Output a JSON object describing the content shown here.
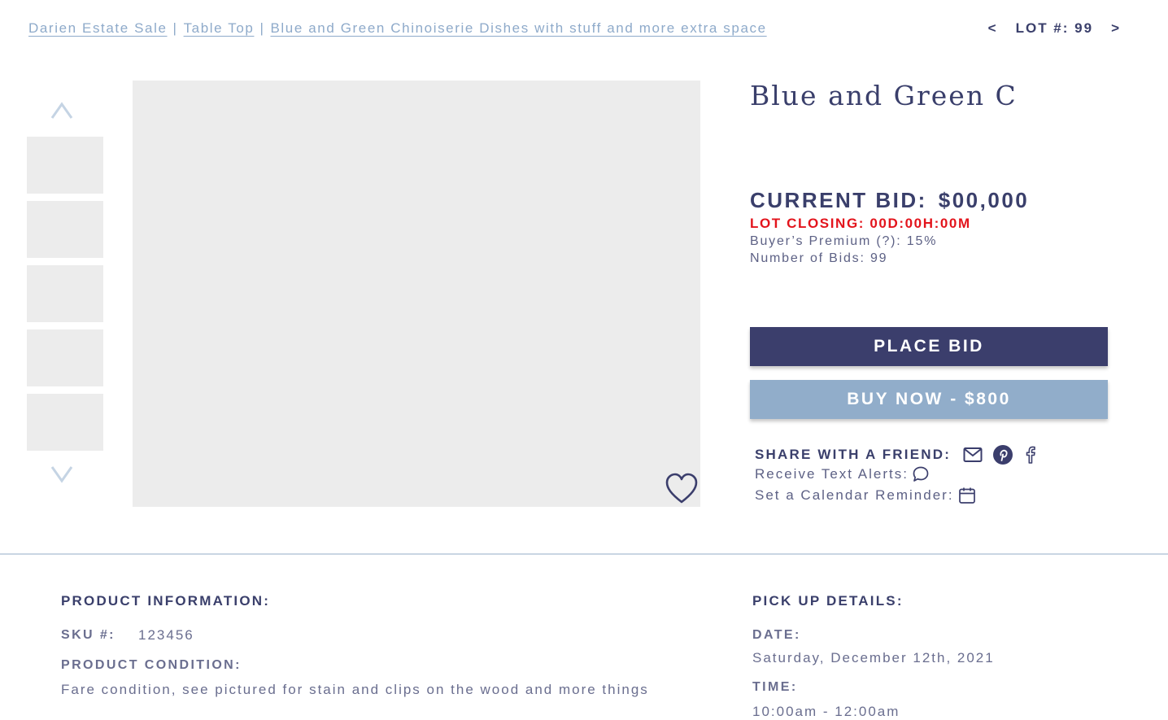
{
  "breadcrumb": {
    "items": [
      "Darien Estate Sale",
      "Table Top",
      "Blue and Green Chinoiserie Dishes with stuff and more extra space"
    ],
    "separator": "|"
  },
  "lot_nav": {
    "prev": "<",
    "label": "LOT #: 99",
    "next": ">"
  },
  "gallery": {
    "up_icon": "chevron-up-icon",
    "down_icon": "chevron-down-icon",
    "thumbnail_count": 5,
    "favorite_icon": "heart-icon"
  },
  "lot": {
    "title": "Blue and Green C",
    "current_bid_label": "CURRENT BID:",
    "current_bid_value": "$00,000",
    "closing": "LOT CLOSING: 00D:00H:00M",
    "buyers_premium": "Buyer’s Premium (?): 15%",
    "number_of_bids": "Number of Bids: 99"
  },
  "actions": {
    "place_bid": "PLACE BID",
    "buy_now": "BUY NOW - $800"
  },
  "share": {
    "label": "SHARE WITH A FRIEND:",
    "icons": [
      "mail-icon",
      "pinterest-icon",
      "facebook-icon"
    ],
    "text_alerts": "Receive Text Alerts:",
    "text_alerts_icon": "chat-bubble-icon",
    "calendar": "Set a Calendar Reminder:",
    "calendar_icon": "calendar-icon"
  },
  "product_info": {
    "heading": "PRODUCT INFORMATION:",
    "sku_label": "SKU #:",
    "sku_value": "123456",
    "condition_label": "PRODUCT CONDITION:",
    "condition_value": "Fare condition, see pictured for stain and clips on the wood and more things"
  },
  "pickup": {
    "heading": "PICK UP DETAILS:",
    "date_label": "DATE:",
    "date_value": "Saturday, December 12th, 2021",
    "time_label": "TIME:",
    "time_value": "10:00am - 12:00am"
  },
  "colors": {
    "navy": "#3b3e6c",
    "light_blue": "#91adca",
    "alert_red": "#e3141c",
    "placeholder_gray": "#ececec"
  }
}
